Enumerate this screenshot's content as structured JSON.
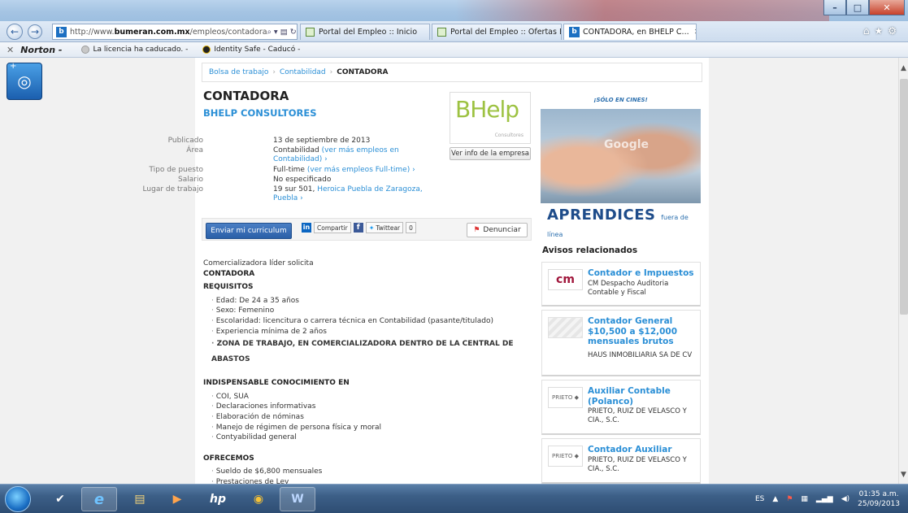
{
  "browser": {
    "address": {
      "prefix": "http://www.",
      "domain": "bumeran.com.mx",
      "path": "/empleos/contadora"
    },
    "tabs": [
      {
        "label": "Portal del Empleo :: Inicio"
      },
      {
        "label": "Portal del Empleo :: Ofertas Em..."
      },
      {
        "label": "CONTADORA, en BHELP C..."
      }
    ],
    "favorites": {
      "norton": "Norton -",
      "items": [
        "La licencia ha caducado. -",
        "Identity Safe - Caducó -"
      ]
    }
  },
  "breadcrumb": [
    "Bolsa de trabajo",
    "Contabilidad",
    "CONTADORA"
  ],
  "job": {
    "title": "CONTADORA",
    "company": "BHELP CONSULTORES",
    "meta": {
      "published_label": "Publicado",
      "published_value": "13 de septiembre de 2013",
      "area_label": "Área",
      "area_value": "Contabilidad",
      "area_link": "(ver más empleos en Contabilidad) ›",
      "type_label": "Tipo de puesto",
      "type_value": "Full-time",
      "type_link": "(ver más empleos Full-time) ›",
      "salary_label": "Salario",
      "salary_value": "No especificado",
      "place_label": "Lugar de trabajo",
      "place_value": "19 sur 501,",
      "place_link": "Heroica Puebla de Zaragoza, Puebla ›"
    },
    "logo": {
      "text": "BHelp",
      "sub": "Consultores"
    },
    "company_info_button": "Ver info de la empresa",
    "apply_button": "Enviar mi curriculum",
    "share": {
      "linkedin": "Compartir",
      "twitter": "Twittear",
      "count": "0"
    },
    "report_button": "Denunciar",
    "description": {
      "intro": "Comercializadora líder solicita",
      "position": "CONTADORA",
      "requirements_title": "REQUISITOS",
      "requirements": [
        "Edad: De 24 a 35 años",
        "Sexo: Femenino",
        "Escolaridad: licencitura o carrera técnica en Contabilidad (pasante/titulado)",
        "Experiencia mínima de 2 años"
      ],
      "zone": "ZONA DE TRABAJO, EN COMERCIALIZADORA DENTRO DE LA CENTRAL DE ABASTOS",
      "knowledge_title": "INDISPENSABLE CONOCIMIENTO EN",
      "knowledge": [
        "COI, SUA",
        "Declaraciones informativas",
        "Elaboración de nóminas",
        "Manejo de régimen de persona física y moral",
        "Contyabilidad general"
      ],
      "offer_title": "OFRECEMOS",
      "offer": [
        "Sueldo de $6,800 mensuales",
        "Prestaciones de Ley"
      ]
    }
  },
  "ad": {
    "tagline": "¡SÓLO EN CINES!",
    "watermark": "Google",
    "brand": "APRENDICES",
    "brand_sub": "fuera de línea"
  },
  "related": {
    "title": "Avisos relacionados",
    "items": [
      {
        "title": "Contador e Impuestos",
        "company": "CM Despacho Auditoria Contable y Fiscal",
        "thumb": "cm"
      },
      {
        "title": "Contador General $10,500 a $12,000 mensuales brutos",
        "company": "HAUS INMOBILIARIA SA DE CV",
        "thumb": ""
      },
      {
        "title": "Auxiliar Contable (Polanco)",
        "company": "PRIETO, RUIZ DE VELASCO Y CIA., S.C.",
        "thumb": "PRIETO ◆"
      },
      {
        "title": "Contador Auxiliar",
        "company": "PRIETO, RUIZ DE VELASCO Y CIA., S.C.",
        "thumb": "PRIETO ◆"
      }
    ]
  },
  "taskbar": {
    "lang": "ES",
    "time": "01:35 a.m.",
    "date": "25/09/2013"
  },
  "colors": {
    "link": "#2b8fd6",
    "apply": "#2a5fa8",
    "logo": "#9dc242"
  }
}
